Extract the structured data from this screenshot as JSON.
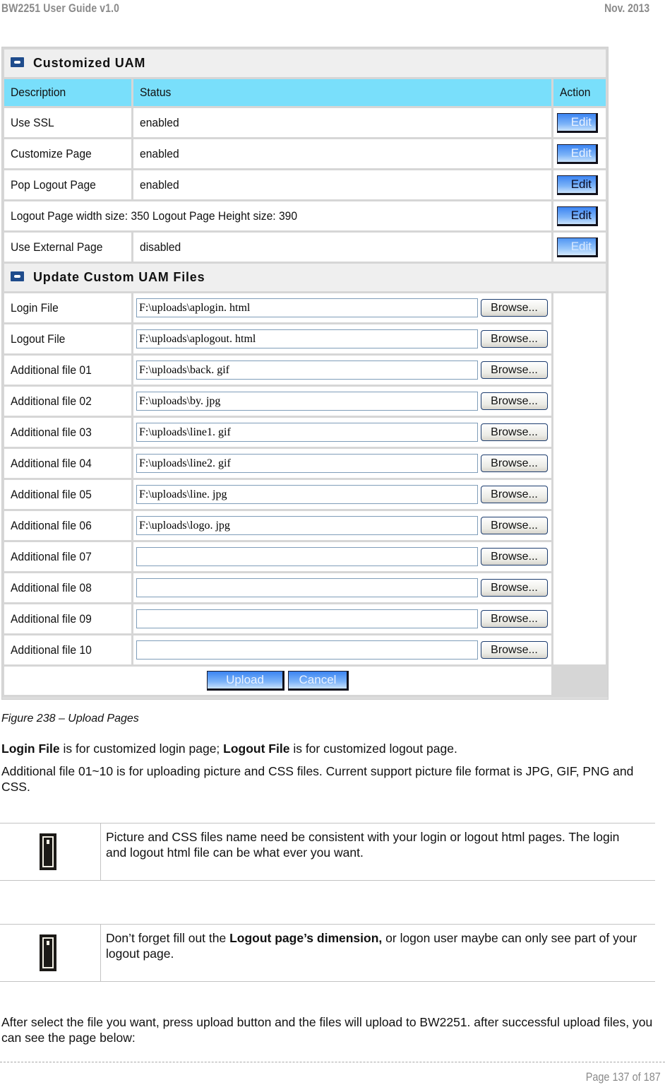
{
  "header": {
    "title": "BW2251 User Guide v1.0",
    "date": "Nov.  2013"
  },
  "panel": {
    "section1": {
      "title": "Customized UAM",
      "columns": [
        "Description",
        "Status",
        "Action"
      ],
      "rows": [
        {
          "description": "Use SSL",
          "status": "enabled",
          "action": "Edit"
        },
        {
          "description": "Customize Page",
          "status": "enabled",
          "action": "Edit"
        },
        {
          "description": "Pop Logout Page",
          "status": "enabled",
          "action": "Edit"
        },
        {
          "description": "Logout Page width size: 350  Logout Page Height size: 390",
          "status": "",
          "action": "Edit"
        },
        {
          "description": "Use External Page",
          "status": "disabled",
          "action": "Edit"
        }
      ]
    },
    "section2": {
      "title": "Update Custom UAM Files",
      "browse_label": "Browse...",
      "files": [
        {
          "label": "Login File",
          "value": "F:\\uploads\\aplogin. html"
        },
        {
          "label": "Logout File",
          "value": "F:\\uploads\\aplogout. html"
        },
        {
          "label": "Additional file 01",
          "value": "F:\\uploads\\back. gif"
        },
        {
          "label": "Additional file 02",
          "value": "F:\\uploads\\by. jpg"
        },
        {
          "label": "Additional file 03",
          "value": "F:\\uploads\\line1. gif"
        },
        {
          "label": "Additional file 04",
          "value": "F:\\uploads\\line2. gif"
        },
        {
          "label": "Additional file 05",
          "value": "F:\\uploads\\line. jpg"
        },
        {
          "label": "Additional file 06",
          "value": "F:\\uploads\\logo. jpg"
        },
        {
          "label": "Additional file 07",
          "value": ""
        },
        {
          "label": "Additional file 08",
          "value": ""
        },
        {
          "label": "Additional file 09",
          "value": ""
        },
        {
          "label": "Additional file 10",
          "value": ""
        }
      ],
      "upload_label": "Upload",
      "cancel_label": "Cancel"
    }
  },
  "caption": "Figure 238 – Upload Pages",
  "para1": {
    "b1": "Login File",
    "t1": " is for customized login page; ",
    "b2": "Logout File",
    "t2": " is for customized logout page."
  },
  "para2": "Additional file 01~10 is for uploading picture and CSS files. Current support picture file format is JPG, GIF, PNG and CSS.",
  "note1": {
    "icon": "info-icon",
    "text": "Picture and CSS files name need be consistent with your login or logout html pages. The login and logout html file can be what ever you want."
  },
  "note2": {
    "icon": "info-icon",
    "t1": "Don’t forget fill out the ",
    "b1": "Logout page’s dimension,",
    "t2": " or logon user maybe can only see part of your logout page."
  },
  "para3": "After select the file you want, press upload button and the files will upload to BW2251. after successful upload files, you can see the page below:",
  "footer": {
    "page": "Page 137 of 187"
  }
}
